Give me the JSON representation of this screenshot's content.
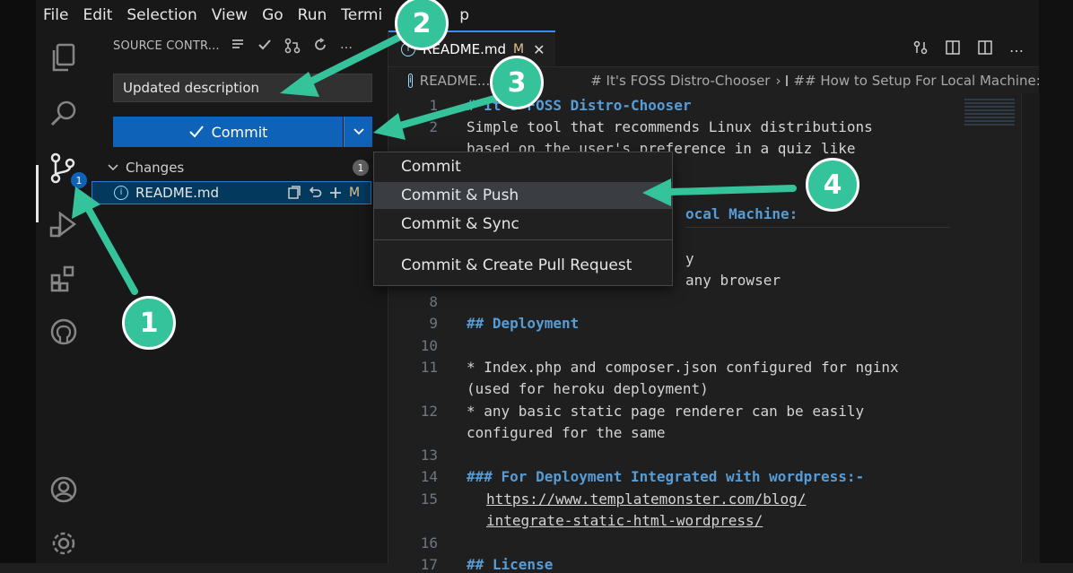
{
  "menu": [
    "File",
    "Edit",
    "Selection",
    "View",
    "Go",
    "Run",
    "Termi",
    "p"
  ],
  "sidebar": {
    "header": "SOURCE CONTR...",
    "commit_message_value": "Updated description",
    "commit_button_label": "Commit",
    "changes_label": "Changes",
    "changes_count": "1",
    "file_name": "README.md",
    "file_status": "M",
    "scm_badge": "1"
  },
  "editor": {
    "tab_label": "README.md",
    "tab_status": "M",
    "breadcrumb": {
      "file": "README...",
      "section1": "# It's FOSS Distro-Chooser",
      "section2": "## How to Setup For Local Machine:"
    },
    "lines": [
      {
        "num": "1",
        "text": "# It's FOSS Distro-Chooser"
      },
      {
        "num": "2",
        "text": "Simple tool that recommends Linux distributions"
      },
      {
        "num": "",
        "text": "based on the user's preference in a quiz like"
      },
      {
        "num": "",
        "text": "ocal Machine:"
      },
      {
        "num": "",
        "text": "y"
      },
      {
        "num": "",
        "text": "any browser"
      },
      {
        "num": "8",
        "text": ""
      },
      {
        "num": "9",
        "text": "## Deployment"
      },
      {
        "num": "10",
        "text": ""
      },
      {
        "num": "11",
        "text": "* Index.php and composer.json configured for nginx"
      },
      {
        "num": "",
        "text": "(used for heroku deployment)"
      },
      {
        "num": "12",
        "text": "* any basic static page renderer can be easily"
      },
      {
        "num": "",
        "text": "configured for the same"
      },
      {
        "num": "13",
        "text": ""
      },
      {
        "num": "14",
        "text": "### For Deployment Integrated with wordpress:-"
      },
      {
        "num": "15",
        "text": "https://www.templatemonster.com/blog/"
      },
      {
        "num": "",
        "text": "integrate-static-html-wordpress/"
      },
      {
        "num": "16",
        "text": ""
      },
      {
        "num": "17",
        "text": "## License"
      }
    ]
  },
  "dropdown": {
    "items": [
      "Commit",
      "Commit & Push",
      "Commit & Sync",
      "Commit & Create Pull Request"
    ]
  },
  "annotations": [
    "1",
    "2",
    "3",
    "4"
  ],
  "colors": {
    "accent_blue": "#0e63b8",
    "annotation_green": "#34c39a",
    "heading_blue": "#569cd6"
  }
}
